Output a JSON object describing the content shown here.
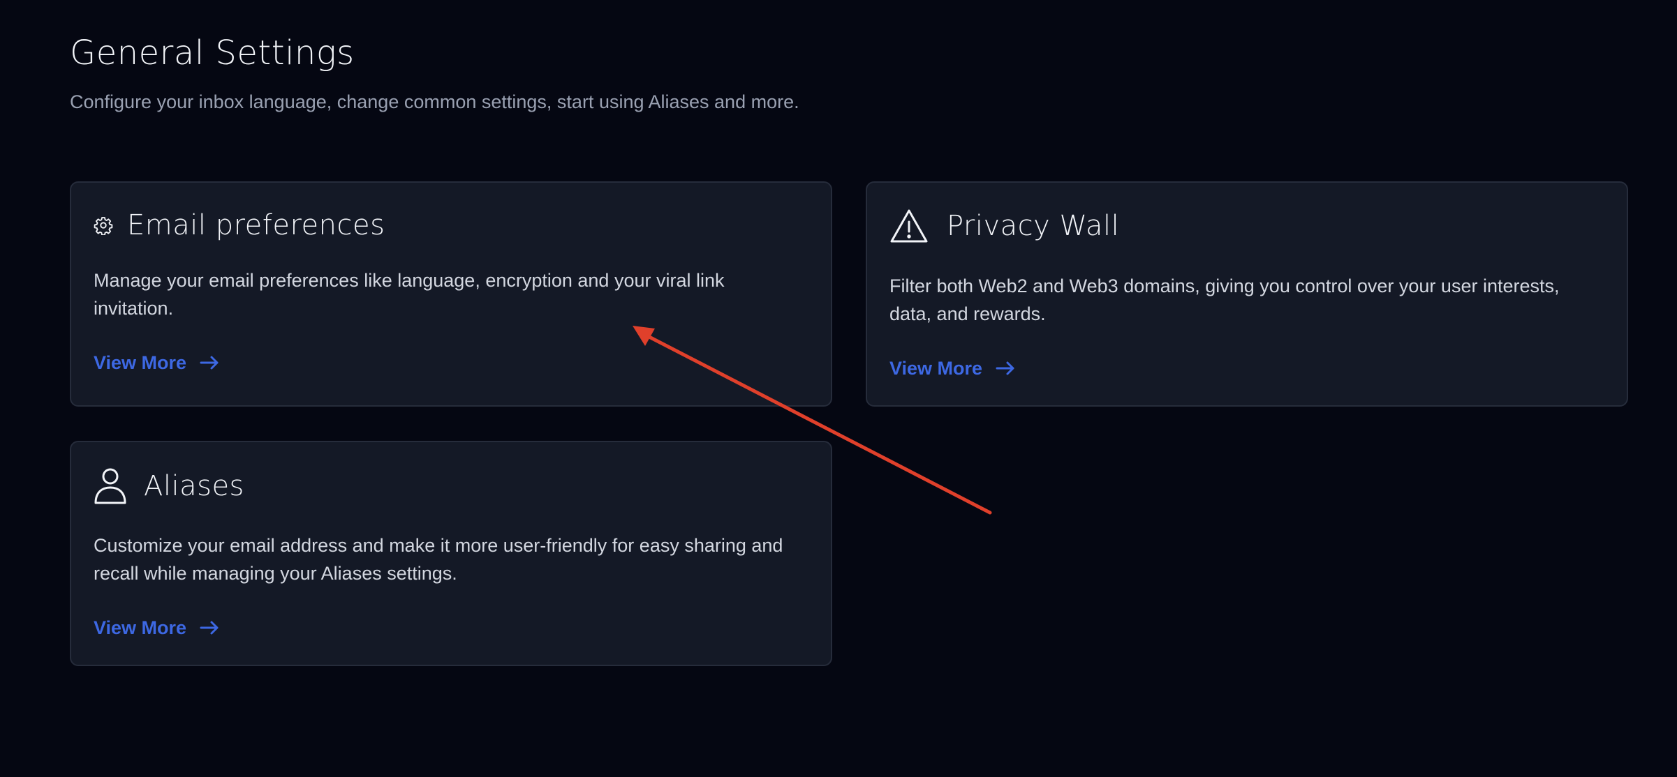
{
  "header": {
    "title": "General Settings",
    "subtitle": "Configure your inbox language, change common settings, start using Aliases and more."
  },
  "cards": {
    "email": {
      "icon": "gear-icon",
      "title": "Email preferences",
      "description": "Manage your email preferences like language, encryption and your viral link invitation.",
      "link_label": "View More"
    },
    "privacy": {
      "icon": "warning-triangle-icon",
      "title": "Privacy Wall",
      "description": "Filter both Web2 and Web3 domains, giving you control over your user interests, data, and rewards.",
      "link_label": "View More"
    },
    "aliases": {
      "icon": "user-icon",
      "title": "Aliases",
      "description": "Customize your email address and make it more user-friendly for easy sharing and recall while managing your Aliases settings.",
      "link_label": "View More"
    }
  },
  "colors": {
    "background": "#050712",
    "card_background": "#141926",
    "card_border": "#262c3b",
    "link": "#3d68e3",
    "annotation_arrow": "#e0402b"
  }
}
